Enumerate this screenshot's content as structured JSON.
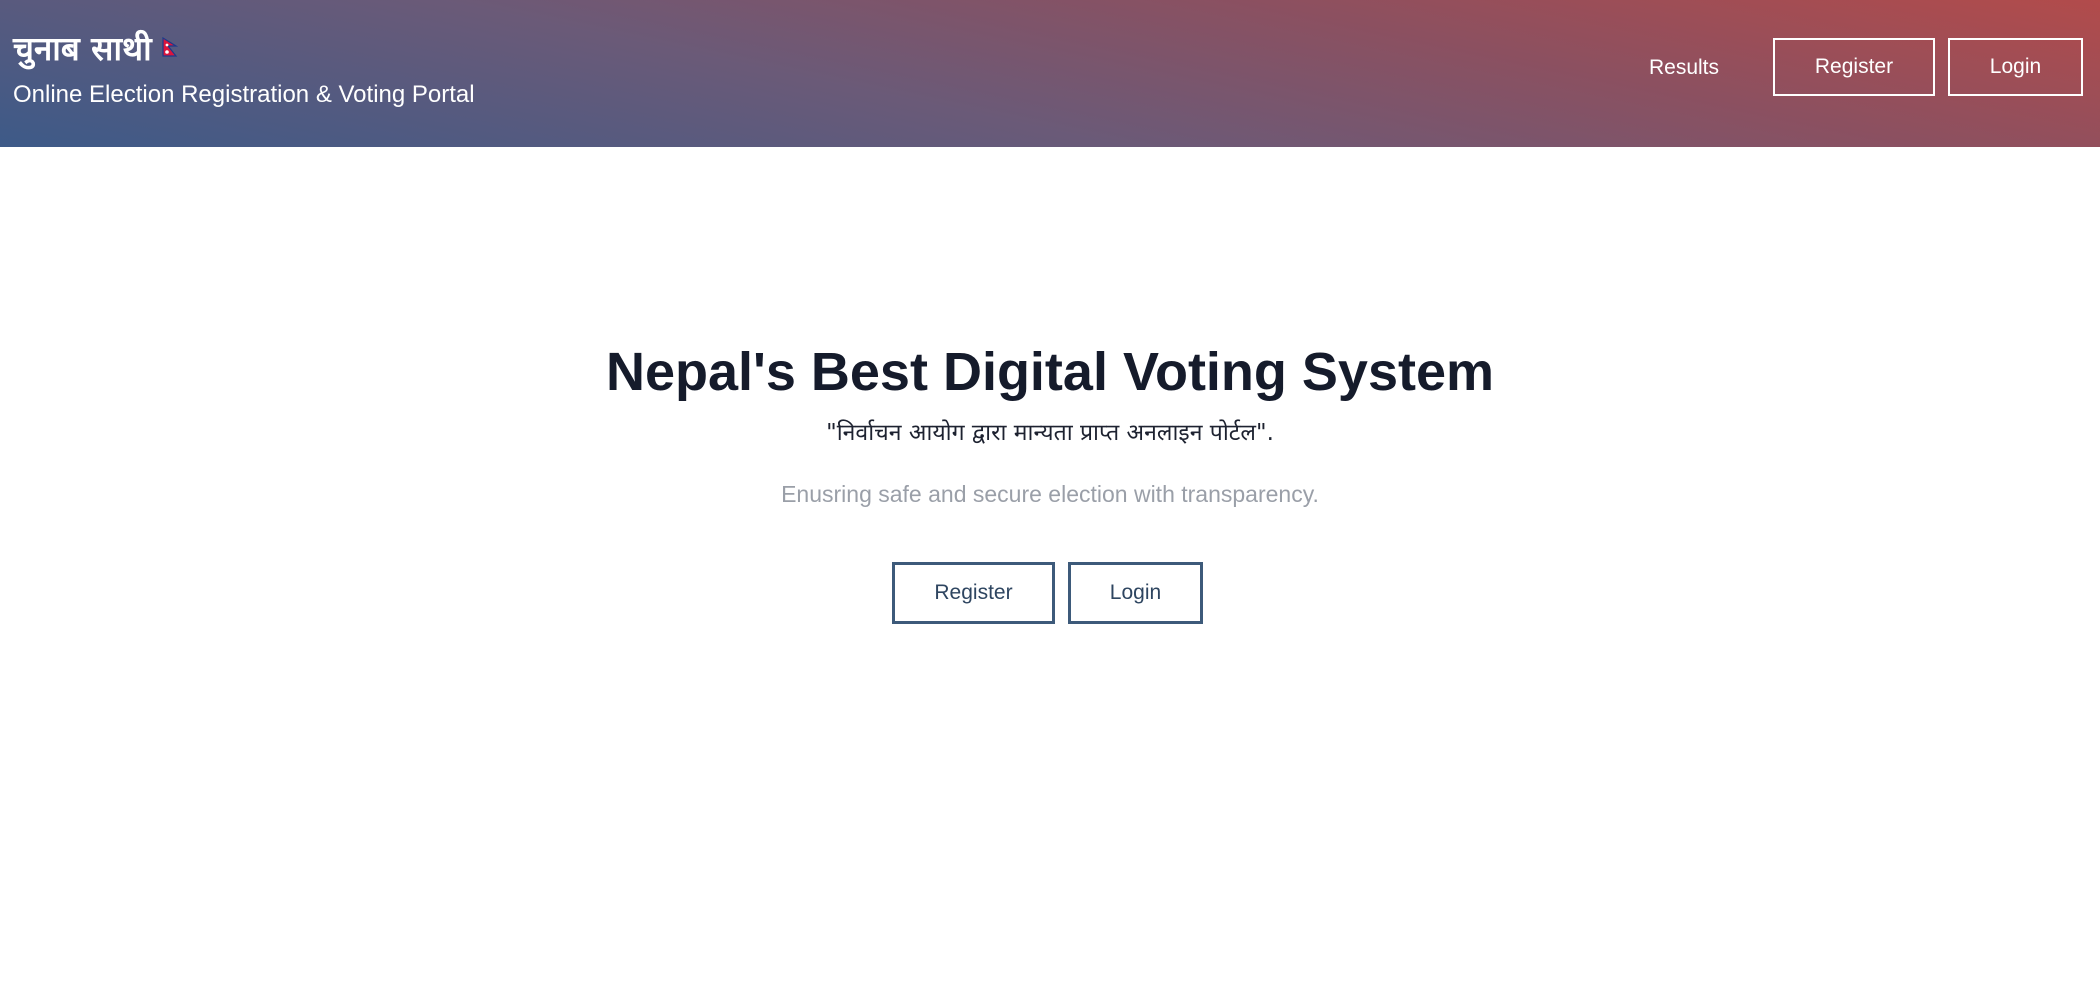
{
  "header": {
    "brand_title": "चुनाब साथी",
    "brand_subtitle": "Online Election Registration & Voting Portal",
    "flag_icon": "nepal-flag-icon",
    "nav": {
      "results_label": "Results",
      "register_label": "Register",
      "login_label": "Login"
    },
    "colors": {
      "gradient_start": "#b24b4b",
      "gradient_end": "#3d5a88"
    }
  },
  "hero": {
    "title": "Nepal's Best Digital Voting System",
    "tagline": "\"निर्वाचन आयोग द्वारा मान्यता प्राप्त अनलाइन पोर्टल\".",
    "subtext": "Enusring safe and secure election with transparency.",
    "register_label": "Register",
    "login_label": "Login",
    "colors": {
      "title": "#151b2b",
      "button_border": "#3d5a7a"
    }
  }
}
